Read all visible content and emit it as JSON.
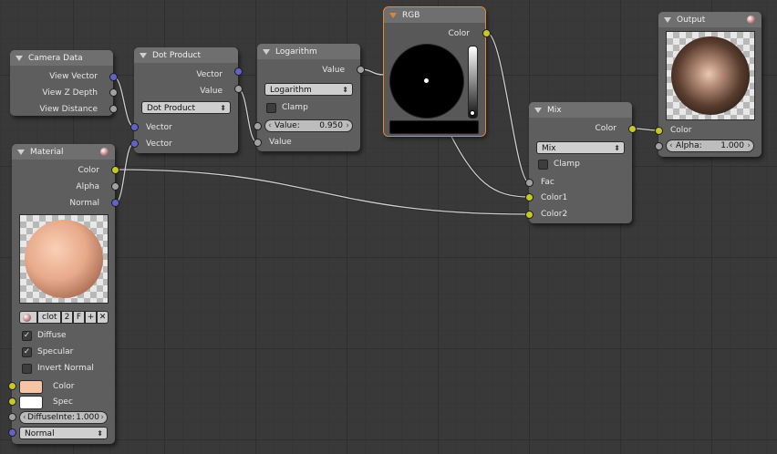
{
  "colors": {
    "background": "#393939",
    "node_body": "#5e5e5e",
    "selected_outline": "#e08a3a",
    "socket_vector": "#6363c7",
    "socket_float": "#a1a1a1",
    "socket_color": "#c7c729",
    "material_color": "#f7c4a6",
    "spec_color": "#ffffff"
  },
  "camera_data": {
    "title": "Camera Data",
    "outputs": [
      "View Vector",
      "View Z Depth",
      "View Distance"
    ]
  },
  "dot_product": {
    "title": "Dot Product",
    "outputs": [
      "Vector",
      "Value"
    ],
    "operation": "Dot Product",
    "inputs": [
      "Vector",
      "Vector"
    ]
  },
  "logarithm": {
    "title": "Logarithm",
    "output": "Value",
    "operation": "Logarithm",
    "clamp_label": "Clamp",
    "value_label": "Value:",
    "value": "0.950",
    "input": "Value"
  },
  "rgb": {
    "title": "RGB",
    "output": "Color"
  },
  "mix": {
    "title": "Mix",
    "output": "Color",
    "blend": "Mix",
    "clamp_label": "Clamp",
    "inputs": [
      "Fac",
      "Color1",
      "Color2"
    ]
  },
  "output": {
    "title": "Output",
    "inputs": [
      "Color"
    ],
    "alpha_label": "Alpha:",
    "alpha_value": "1.000"
  },
  "material": {
    "title": "Material",
    "outputs": [
      "Color",
      "Alpha",
      "Normal"
    ],
    "datablock_name": "clot",
    "user_count": "2",
    "fake_user": "F",
    "options": [
      {
        "label": "Diffuse",
        "checked": true
      },
      {
        "label": "Specular",
        "checked": true
      },
      {
        "label": "Invert Normal",
        "checked": false
      }
    ],
    "color_label": "Color",
    "spec_label": "Spec",
    "diffuse_label": "DiffuseInte:",
    "diffuse_value": "1.000",
    "normal_select": "Normal"
  }
}
